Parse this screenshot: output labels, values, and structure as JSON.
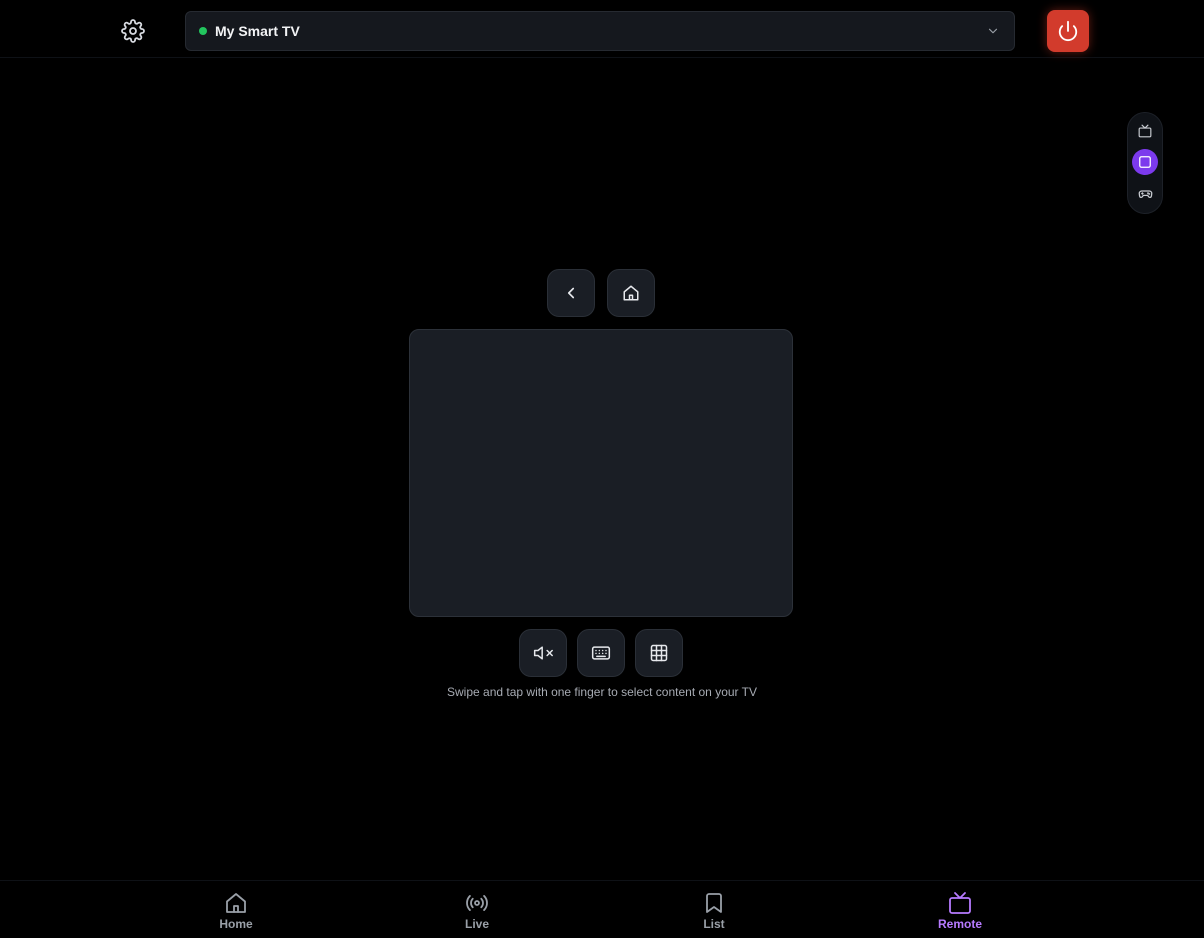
{
  "header": {
    "device": {
      "name": "My Smart TV",
      "status_color": "#22c55e"
    },
    "settings_icon": "gear-icon",
    "power_icon": "power-icon",
    "power_color": "#d23b2c"
  },
  "mode_switch": {
    "items": [
      {
        "icon": "tv-icon",
        "active": false
      },
      {
        "icon": "trackpad-icon",
        "active": true
      },
      {
        "icon": "gamepad-icon",
        "active": false
      }
    ],
    "accent": "#7c3aed"
  },
  "remote": {
    "top_buttons": [
      {
        "icon": "chevron-left-icon"
      },
      {
        "icon": "home-icon"
      }
    ],
    "bottom_buttons": [
      {
        "icon": "mute-icon"
      },
      {
        "icon": "keyboard-icon"
      },
      {
        "icon": "grid-icon"
      }
    ],
    "hint": "Swipe and tap with one finger to select content on your TV"
  },
  "nav": {
    "items": [
      {
        "label": "Home",
        "icon": "home-icon",
        "active": false
      },
      {
        "label": "Live",
        "icon": "broadcast-icon",
        "active": false
      },
      {
        "label": "List",
        "icon": "bookmark-icon",
        "active": false
      },
      {
        "label": "Remote",
        "icon": "tv-icon",
        "active": true
      }
    ],
    "active_color": "#b77bff"
  }
}
